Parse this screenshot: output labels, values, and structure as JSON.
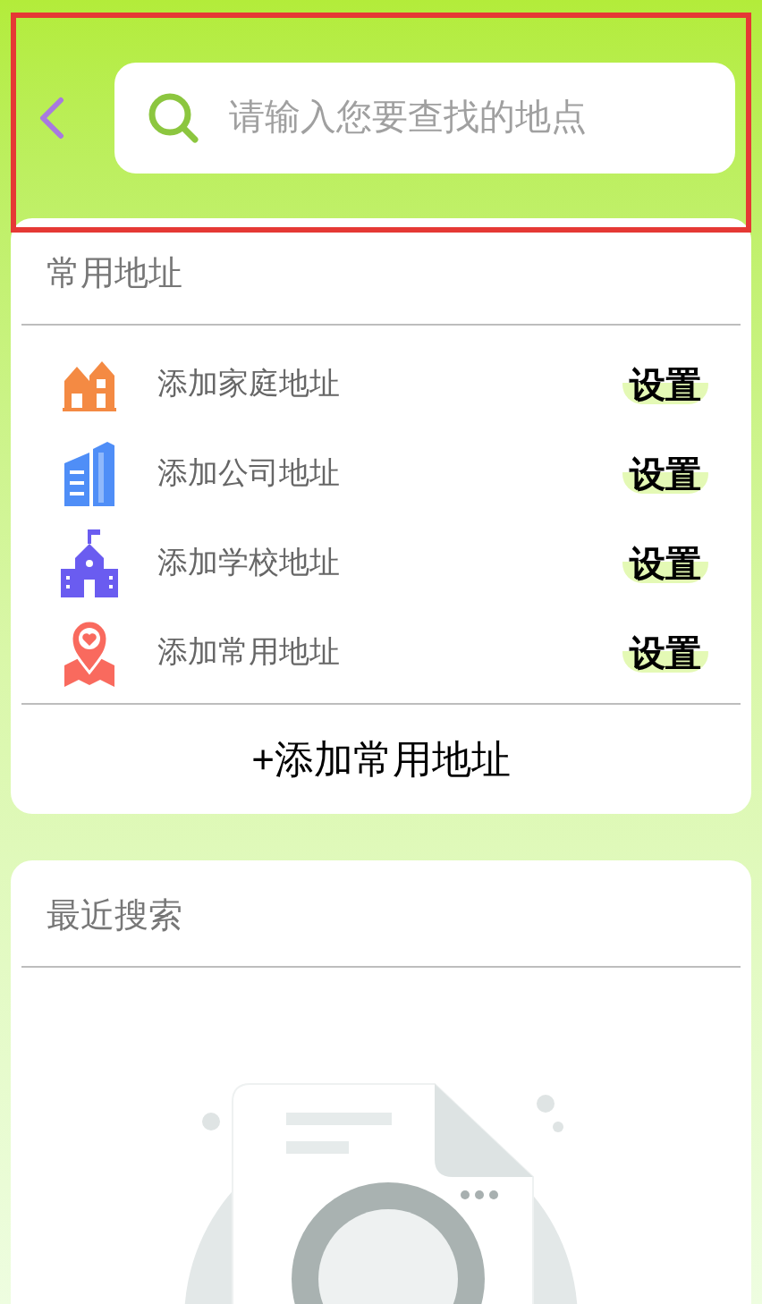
{
  "search": {
    "placeholder": "请输入您要查找的地点"
  },
  "frequent": {
    "title": "常用地址",
    "items": [
      {
        "kind": "home",
        "label": "添加家庭地址",
        "action": "设置"
      },
      {
        "kind": "office",
        "label": "添加公司地址",
        "action": "设置"
      },
      {
        "kind": "school",
        "label": "添加学校地址",
        "action": "设置"
      },
      {
        "kind": "pin",
        "label": "添加常用地址",
        "action": "设置"
      }
    ],
    "add_button": "+添加常用地址"
  },
  "recent": {
    "title": "最近搜索"
  }
}
